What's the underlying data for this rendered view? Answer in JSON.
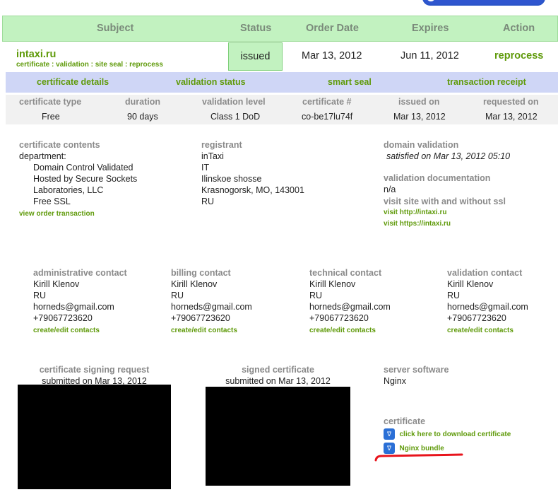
{
  "header": {
    "subject": "Subject",
    "status": "Status",
    "order_date": "Order Date",
    "expires": "Expires",
    "action": "Action"
  },
  "order": {
    "domain": "intaxi.ru",
    "sublinks": [
      "certificate",
      "validation",
      "site seal",
      "reprocess"
    ],
    "status": "issued",
    "order_date": "Mar 13, 2012",
    "expires": "Jun 11, 2012",
    "action": "reprocess"
  },
  "tabs": [
    "certificate details",
    "validation status",
    "smart seal",
    "transaction receipt"
  ],
  "info": {
    "headers": [
      "certificate type",
      "duration",
      "validation level",
      "certificate #",
      "issued on",
      "requested on"
    ],
    "values": [
      "Free",
      "90 days",
      "Class 1 DoD",
      "co-be17lu74f",
      "Mar 13, 2012",
      "Mar 13, 2012"
    ]
  },
  "contents": {
    "title": "certificate contents",
    "dept_label": "department:",
    "lines": [
      "Domain Control Validated",
      "Hosted by Secure Sockets",
      "Laboratories, LLC",
      "Free SSL"
    ],
    "link": "view order transaction"
  },
  "registrant": {
    "title": "registrant",
    "lines": [
      "inTaxi",
      "IT",
      "Ilinskoe shosse",
      "Krasnogorsk, MO, 143001",
      "RU"
    ]
  },
  "domain_validation": {
    "title": "domain validation",
    "status": "satisfied on Mar 13, 2012 05:10",
    "doc_title": "validation documentation",
    "doc_value": "n/a",
    "visit_title": "visit site with and without ssl",
    "visit_http": "visit http://intaxi.ru",
    "visit_https": "visit https://intaxi.ru"
  },
  "contacts": [
    {
      "title": "administrative contact",
      "name": "Kirill Klenov",
      "country": "RU",
      "email": "horneds@gmail.com",
      "phone": "+79067723620",
      "link": "create/edit contacts"
    },
    {
      "title": "billing contact",
      "name": "Kirill Klenov",
      "country": "RU",
      "email": "horneds@gmail.com",
      "phone": "+79067723620",
      "link": "create/edit contacts"
    },
    {
      "title": "technical contact",
      "name": "Kirill Klenov",
      "country": "RU",
      "email": "horneds@gmail.com",
      "phone": "+79067723620",
      "link": "create/edit contacts"
    },
    {
      "title": "validation contact",
      "name": "Kirill Klenov",
      "country": "RU",
      "email": "horneds@gmail.com",
      "phone": "+79067723620",
      "link": "create/edit contacts"
    }
  ],
  "csr": {
    "title": "certificate signing request",
    "submitted": "submitted on Mar 13, 2012"
  },
  "signed": {
    "title": "signed certificate",
    "submitted": "submitted on Mar 13, 2012"
  },
  "server": {
    "title": "server software",
    "value": "Nginx"
  },
  "certificate": {
    "title": "certificate",
    "download": "click here to download certificate",
    "bundle": "Nginx bundle"
  },
  "colors": {
    "accent": "#5f9a0a",
    "header_bg": "#c2f2c0",
    "tabs_bg": "#cfd6f6",
    "annotation": "#e8141c"
  }
}
